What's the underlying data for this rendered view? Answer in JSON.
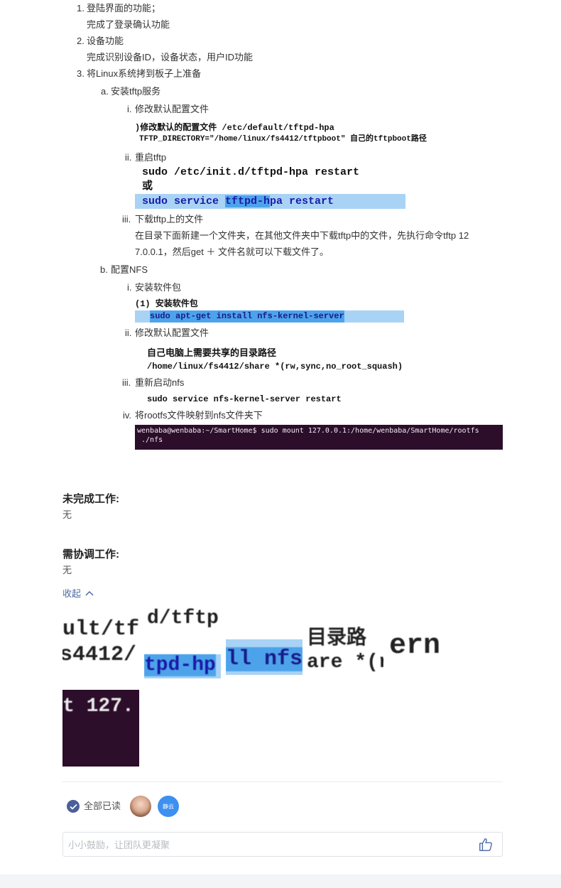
{
  "list": {
    "item1": {
      "marker": "1.",
      "title": "登陆界面的功能；",
      "desc": "完成了登录确认功能"
    },
    "item2": {
      "marker": "2.",
      "title": "设备功能",
      "desc": "完成识别设备ID，设备状态，用户ID功能"
    },
    "item3": {
      "marker": "3.",
      "title": "将Linux系统拷到板子上准备",
      "a": {
        "marker": "a.",
        "title": "安装tftp服务",
        "i": {
          "marker": "i.",
          "title": "修改默认配置文件"
        },
        "ii": {
          "marker": "ii.",
          "title": "重启tftp"
        },
        "iii": {
          "marker": "iii.",
          "title": "下载tftp上的文件",
          "desc1": "在目录下面新建一个文件夹，在其他文件夹中下载tftp中的文件，先执行命令tftp 12",
          "desc2": "7.0.0.1，然后get ＋ 文件名就可以下载文件了。"
        }
      },
      "b": {
        "marker": "b.",
        "title": "配置NFS",
        "i": {
          "marker": "i.",
          "title": "安装软件包"
        },
        "ii": {
          "marker": "ii.",
          "title": "修改默认配置文件"
        },
        "iii": {
          "marker": "iii.",
          "title": "重新启动nfs"
        },
        "iv": {
          "marker": "iv.",
          "title": "将rootfs文件映射到nfs文件夹下"
        }
      }
    }
  },
  "images": {
    "tftp_config": {
      "line1": ")修改默认的配置文件 /etc/default/tftpd-hpa",
      "line2": "TFTP_DIRECTORY=\"/home/linux/fs4412/tftpboot\" 自己的tftpboot路径"
    },
    "tftp_restart": {
      "line1": "sudo /etc/init.d/tftpd-hpa restart",
      "line2": "或",
      "line3a": "sudo service ",
      "line3b": "tftpd-h",
      "line3c": "pa restart"
    },
    "nfs_install": {
      "line1": "(1) 安装软件包",
      "line2": "sudo apt-get install nfs-kernel-server"
    },
    "nfs_config": {
      "line1": "自己电脑上需要共享的目录路径",
      "line2": "/home/linux/fs4412/share *(rw,sync,no_root_squash)"
    },
    "nfs_restart": {
      "line1": "sudo service nfs-kernel-server restart"
    },
    "terminal": {
      "line1": "wenbaba@wenbaba:~/SmartHome$ sudo mount 127.0.0.1:/home/wenbaba/SmartHome/rootfs",
      "line2": " ./nfs"
    }
  },
  "sections": {
    "unfinished": {
      "title": "未完成工作:",
      "value": "无"
    },
    "coordination": {
      "title": "需协调工作:",
      "value": "无"
    }
  },
  "collapse_label": "收起",
  "thumbnails": {
    "t1": {
      "l1": "ult/tf",
      "l2": "s4412/"
    },
    "t2": {
      "l1": "d/tftp",
      "l2": "tpd-hp"
    },
    "t3": {
      "l1": "ll nfs"
    },
    "t4": {
      "l1": "目录路",
      "l2": "are *(r"
    },
    "t5": {
      "l1": "ern"
    },
    "t6": {
      "l1": "t 127."
    }
  },
  "footer": {
    "read_status": "全部已读",
    "reader2": "静云",
    "comment_placeholder": "小小鼓励，让团队更凝聚"
  },
  "colors": {
    "accent": "#4a6aa5",
    "selection": "#a9d3f5",
    "terminal_bg": "#2c0e2b",
    "avatar_blue": "#3d8ff0"
  }
}
